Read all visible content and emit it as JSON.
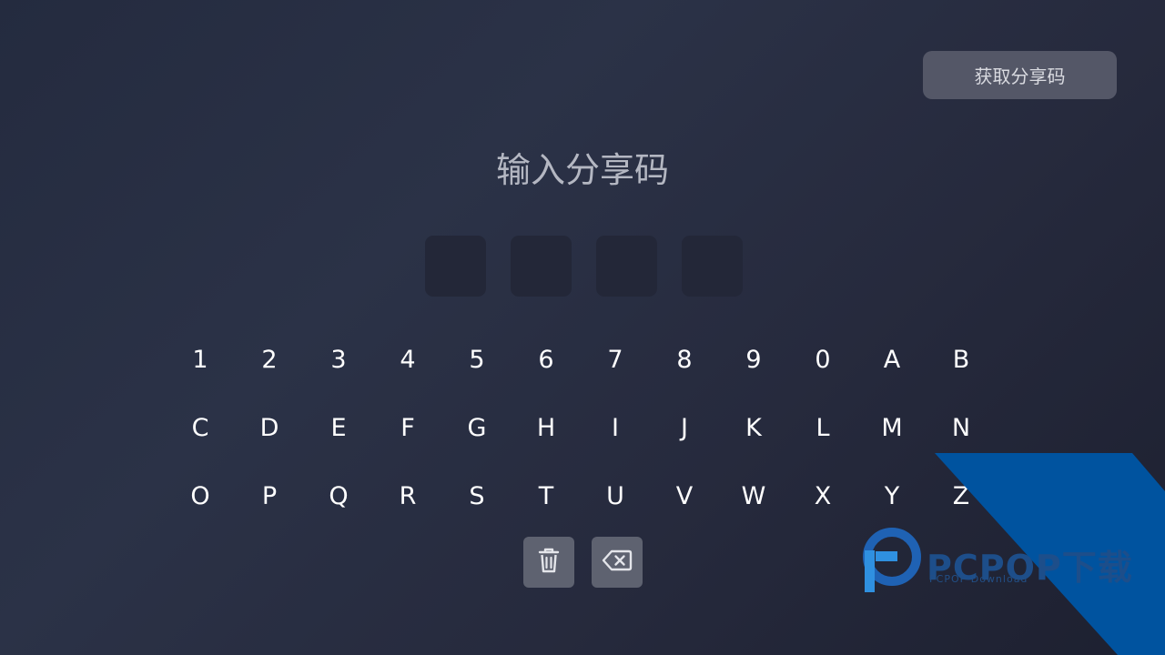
{
  "header": {
    "get_code_label": "获取分享码"
  },
  "main": {
    "title": "输入分享码",
    "code_slots": [
      "",
      "",
      "",
      ""
    ]
  },
  "keyboard": {
    "rows": [
      [
        "1",
        "2",
        "3",
        "4",
        "5",
        "6",
        "7",
        "8",
        "9",
        "0",
        "A",
        "B"
      ],
      [
        "C",
        "D",
        "E",
        "F",
        "G",
        "H",
        "I",
        "J",
        "K",
        "L",
        "M",
        "N"
      ],
      [
        "O",
        "P",
        "Q",
        "R",
        "S",
        "T",
        "U",
        "V",
        "W",
        "X",
        "Y",
        "Z"
      ]
    ],
    "actions": [
      {
        "name": "clear",
        "icon": "trash-icon"
      },
      {
        "name": "backspace",
        "icon": "backspace-icon"
      }
    ]
  },
  "watermark": {
    "brand": "PCPOP下载",
    "sub": "PCPOP Download",
    "color": "#00539f"
  },
  "colors": {
    "accent_button": "#545767",
    "code_box": "#232738",
    "key_text": "#ffffff"
  }
}
